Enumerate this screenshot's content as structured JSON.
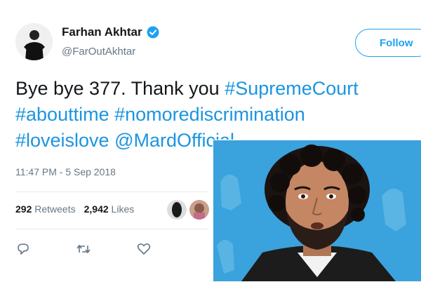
{
  "tweet": {
    "author_name": "Farhan Akhtar",
    "handle": "@FarOutAkhtar",
    "follow_label": "Follow",
    "text_plain": "Bye bye 377. Thank you ",
    "hashtags": [
      "#SupremeCourt",
      "#abouttime",
      "#nomorediscrimination",
      "#loveislove"
    ],
    "mention": "@MardOfficial",
    "timestamp": "11:47 PM - 5 Sep 2018",
    "retweets_count": "292",
    "retweets_label": "Retweets",
    "likes_count": "2,942",
    "likes_label": "Likes"
  },
  "icons": {
    "verified": "verified-badge-icon",
    "reply": "reply-icon",
    "retweet": "retweet-icon",
    "like": "heart-icon"
  },
  "colors": {
    "accent": "#1da1f2",
    "link": "#1b95e0",
    "muted": "#657786",
    "photo_bg": "#3aa2dc"
  }
}
